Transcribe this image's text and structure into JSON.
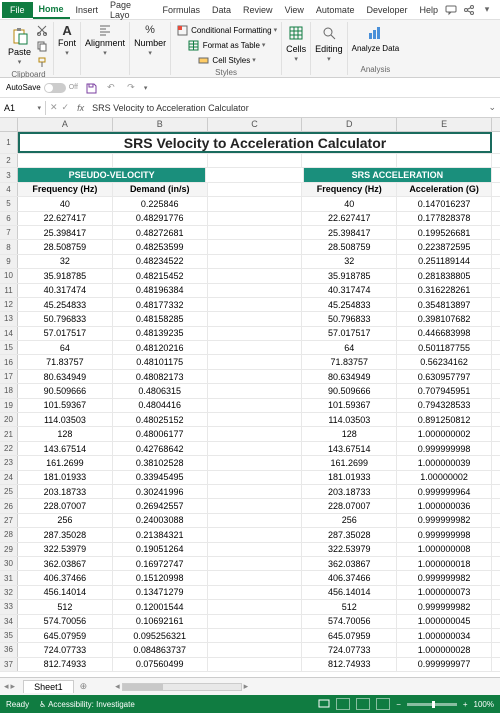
{
  "menu": {
    "file": "File",
    "home": "Home",
    "insert": "Insert",
    "pagelayout": "Page Layo",
    "formulas": "Formulas",
    "data": "Data",
    "review": "Review",
    "view": "View",
    "automate": "Automate",
    "developer": "Developer",
    "help": "Help"
  },
  "ribbon": {
    "clipboard": {
      "paste": "Paste",
      "label": "Clipboard"
    },
    "font": {
      "btn": "Font"
    },
    "alignment": {
      "btn": "Alignment"
    },
    "number": {
      "btn": "Number"
    },
    "styles": {
      "cond": "Conditional Formatting",
      "table": "Format as Table",
      "cell": "Cell Styles",
      "label": "Styles"
    },
    "cells": {
      "btn": "Cells"
    },
    "editing": {
      "btn": "Editing"
    },
    "analysis": {
      "btn": "Analyze Data",
      "label": "Analysis"
    }
  },
  "qat": {
    "autosave": "AutoSave",
    "off": "Off"
  },
  "formula": {
    "cell": "A1",
    "value": "SRS Velocity to Acceleration Calculator"
  },
  "columns": [
    "A",
    "B",
    "C",
    "D",
    "E"
  ],
  "sheet": {
    "title": "SRS Velocity to Acceleration Calculator",
    "section1": "PSEUDO-VELOCITY",
    "section2": "SRS ACCELERATION",
    "h_freq": "Frequency (Hz)",
    "h_demand": "Demand (in/s)",
    "h_accel": "Acceleration (G)"
  },
  "chart_data": {
    "type": "table",
    "rows": [
      {
        "n": 5,
        "f1": "40",
        "d": "0.225846",
        "f2": "40",
        "a": "0.147016237"
      },
      {
        "n": 6,
        "f1": "22.627417",
        "d": "0.48291776",
        "f2": "22.627417",
        "a": "0.177828378"
      },
      {
        "n": 7,
        "f1": "25.398417",
        "d": "0.48272681",
        "f2": "25.398417",
        "a": "0.199526681"
      },
      {
        "n": 8,
        "f1": "28.508759",
        "d": "0.48253599",
        "f2": "28.508759",
        "a": "0.223872595"
      },
      {
        "n": 9,
        "f1": "32",
        "d": "0.48234522",
        "f2": "32",
        "a": "0.251189144"
      },
      {
        "n": 10,
        "f1": "35.918785",
        "d": "0.48215452",
        "f2": "35.918785",
        "a": "0.281838805"
      },
      {
        "n": 11,
        "f1": "40.317474",
        "d": "0.48196384",
        "f2": "40.317474",
        "a": "0.316228261"
      },
      {
        "n": 12,
        "f1": "45.254833",
        "d": "0.48177332",
        "f2": "45.254833",
        "a": "0.354813897"
      },
      {
        "n": 13,
        "f1": "50.796833",
        "d": "0.48158285",
        "f2": "50.796833",
        "a": "0.398107682"
      },
      {
        "n": 14,
        "f1": "57.017517",
        "d": "0.48139235",
        "f2": "57.017517",
        "a": "0.446683998"
      },
      {
        "n": 15,
        "f1": "64",
        "d": "0.48120216",
        "f2": "64",
        "a": "0.501187755"
      },
      {
        "n": 16,
        "f1": "71.83757",
        "d": "0.48101175",
        "f2": "71.83757",
        "a": "0.56234162"
      },
      {
        "n": 17,
        "f1": "80.634949",
        "d": "0.48082173",
        "f2": "80.634949",
        "a": "0.630957797"
      },
      {
        "n": 18,
        "f1": "90.509666",
        "d": "0.4806315",
        "f2": "90.509666",
        "a": "0.707945951"
      },
      {
        "n": 19,
        "f1": "101.59367",
        "d": "0.4804416",
        "f2": "101.59367",
        "a": "0.794328533"
      },
      {
        "n": 20,
        "f1": "114.03503",
        "d": "0.48025152",
        "f2": "114.03503",
        "a": "0.891250812"
      },
      {
        "n": 21,
        "f1": "128",
        "d": "0.48006177",
        "f2": "128",
        "a": "1.000000002"
      },
      {
        "n": 22,
        "f1": "143.67514",
        "d": "0.42768642",
        "f2": "143.67514",
        "a": "0.999999998"
      },
      {
        "n": 23,
        "f1": "161.2699",
        "d": "0.38102528",
        "f2": "161.2699",
        "a": "1.000000039"
      },
      {
        "n": 24,
        "f1": "181.01933",
        "d": "0.33945495",
        "f2": "181.01933",
        "a": "1.00000002"
      },
      {
        "n": 25,
        "f1": "203.18733",
        "d": "0.30241996",
        "f2": "203.18733",
        "a": "0.999999964"
      },
      {
        "n": 26,
        "f1": "228.07007",
        "d": "0.26942557",
        "f2": "228.07007",
        "a": "1.000000036"
      },
      {
        "n": 27,
        "f1": "256",
        "d": "0.24003088",
        "f2": "256",
        "a": "0.999999982"
      },
      {
        "n": 28,
        "f1": "287.35028",
        "d": "0.21384321",
        "f2": "287.35028",
        "a": "0.999999998"
      },
      {
        "n": 29,
        "f1": "322.53979",
        "d": "0.19051264",
        "f2": "322.53979",
        "a": "1.000000008"
      },
      {
        "n": 30,
        "f1": "362.03867",
        "d": "0.16972747",
        "f2": "362.03867",
        "a": "1.000000018"
      },
      {
        "n": 31,
        "f1": "406.37466",
        "d": "0.15120998",
        "f2": "406.37466",
        "a": "0.999999982"
      },
      {
        "n": 32,
        "f1": "456.14014",
        "d": "0.13471279",
        "f2": "456.14014",
        "a": "1.000000073"
      },
      {
        "n": 33,
        "f1": "512",
        "d": "0.12001544",
        "f2": "512",
        "a": "0.999999982"
      },
      {
        "n": 34,
        "f1": "574.70056",
        "d": "0.10692161",
        "f2": "574.70056",
        "a": "1.000000045"
      },
      {
        "n": 35,
        "f1": "645.07959",
        "d": "0.095256321",
        "f2": "645.07959",
        "a": "1.000000034"
      },
      {
        "n": 36,
        "f1": "724.07733",
        "d": "0.084863737",
        "f2": "724.07733",
        "a": "1.000000028"
      },
      {
        "n": 37,
        "f1": "812.74933",
        "d": "0.07560499",
        "f2": "812.74933",
        "a": "0.999999977"
      }
    ]
  },
  "tabs": {
    "sheet1": "Sheet1"
  },
  "status": {
    "ready": "Ready",
    "access": "Accessibility: Investigate",
    "zoom": "100%"
  }
}
